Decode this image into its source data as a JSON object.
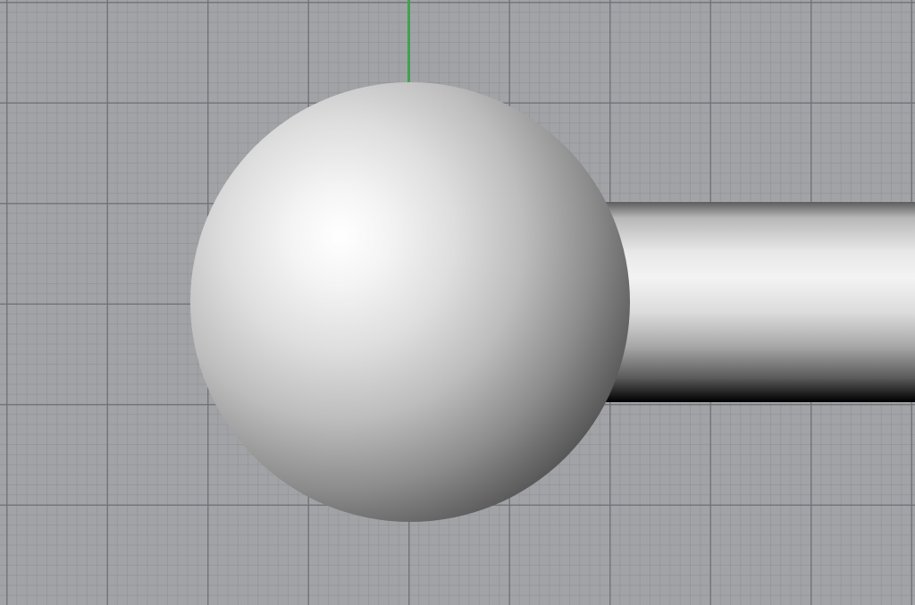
{
  "viewport": {
    "projection": "Top",
    "grid": true,
    "background_color": "#a2a3a6",
    "grid_major_color": "#6e7076",
    "grid_minor_color": "#8c8e94",
    "axis_y_color": "#3fa34d"
  },
  "objects": [
    {
      "name": "sphere",
      "shading": "rendered"
    },
    {
      "name": "cylinder",
      "shading": "rendered"
    }
  ]
}
